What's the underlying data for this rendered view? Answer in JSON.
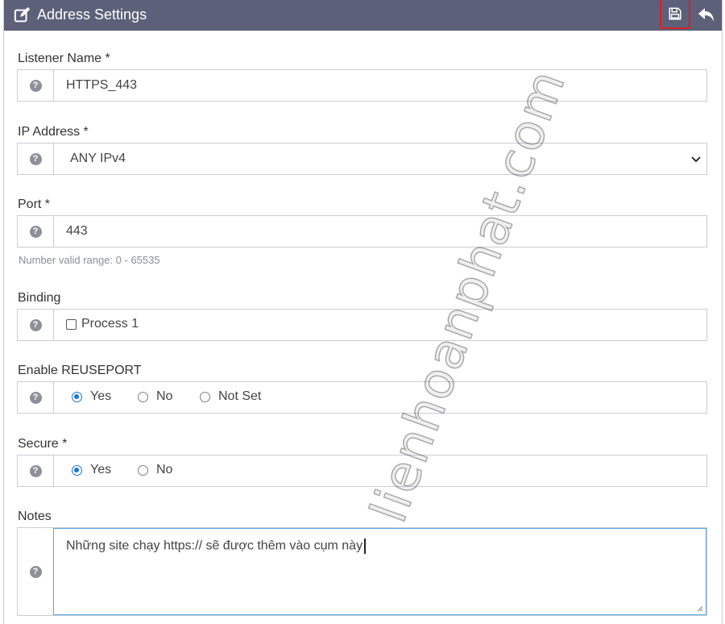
{
  "header": {
    "title": "Address Settings",
    "edit_icon": "edit-square-icon",
    "save_icon": "floppy-disk-icon",
    "back_icon": "undo-arrow-icon",
    "colors": {
      "bar": "#5c6078",
      "highlight": "#d8202a"
    }
  },
  "fields": {
    "listener_name": {
      "label": "Listener Name *",
      "value": "HTTPS_443"
    },
    "ip_address": {
      "label": "IP Address *",
      "value": "ANY IPv4"
    },
    "port": {
      "label": "Port *",
      "value": "443",
      "hint": "Number valid range: 0 - 65535"
    },
    "binding": {
      "label": "Binding",
      "option": "Process 1",
      "checked": false
    },
    "reuseport": {
      "label": "Enable REUSEPORT",
      "options": [
        "Yes",
        "No",
        "Not Set"
      ],
      "selected": "Yes"
    },
    "secure": {
      "label": "Secure *",
      "options": [
        "Yes",
        "No"
      ],
      "selected": "Yes"
    },
    "notes": {
      "label": "Notes",
      "value": "Những site chạy https:// sẽ được thêm vào cụm này"
    }
  },
  "help_icon": "question-circle-icon",
  "watermark": "lienhoanphat.com"
}
